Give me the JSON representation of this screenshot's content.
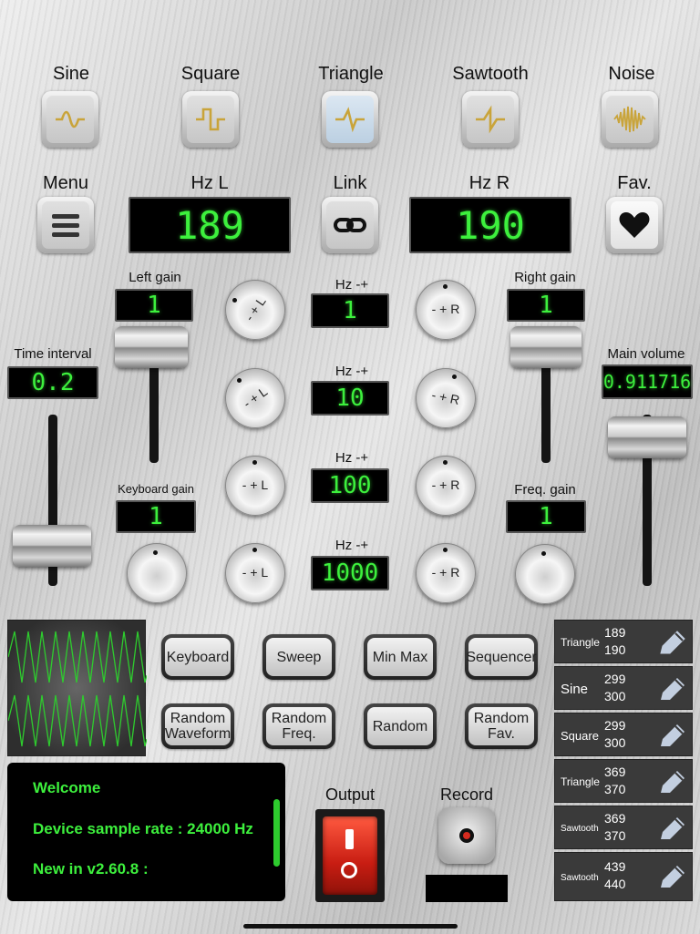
{
  "waveforms": [
    {
      "label": "Sine",
      "icon": "sine-wave-icon",
      "selected": false
    },
    {
      "label": "Square",
      "icon": "square-wave-icon",
      "selected": false
    },
    {
      "label": "Triangle",
      "icon": "triangle-wave-icon",
      "selected": true
    },
    {
      "label": "Sawtooth",
      "icon": "sawtooth-wave-icon",
      "selected": false
    },
    {
      "label": "Noise",
      "icon": "noise-wave-icon",
      "selected": false
    }
  ],
  "top": {
    "menu_label": "Menu",
    "hz_left_label": "Hz L",
    "hz_left_value": "189",
    "link_label": "Link",
    "hz_right_label": "Hz R",
    "hz_right_value": "190",
    "fav_label": "Fav."
  },
  "left": {
    "gain_label": "Left gain",
    "gain_value": "1",
    "keyboard_gain_label": "Keyboard gain",
    "keyboard_gain_value": "1",
    "time_interval_label": "Time interval",
    "time_interval_value": "0.2"
  },
  "right": {
    "gain_label": "Right gain",
    "gain_value": "1",
    "freq_gain_label": "Freq. gain",
    "freq_gain_value": "1",
    "main_volume_label": "Main volume",
    "main_volume_value": "0.911716"
  },
  "steps": [
    {
      "label": "Hz -+",
      "value": "1",
      "knob_l": "- + L",
      "knob_r": "- + R"
    },
    {
      "label": "Hz -+",
      "value": "10",
      "knob_l": "- + L",
      "knob_r": "- + R"
    },
    {
      "label": "Hz -+",
      "value": "100",
      "knob_l": "- + L",
      "knob_r": "- + R"
    },
    {
      "label": "Hz -+",
      "value": "1000",
      "knob_l": "- + L",
      "knob_r": "- + R"
    }
  ],
  "modes": [
    "Keyboard",
    "Sweep",
    "Min Max",
    "Sequencer",
    "Random Waveform",
    "Random Freq.",
    "Random",
    "Random Fav."
  ],
  "messages": [
    "Welcome",
    "Device sample rate : 24000 Hz",
    "New in v2.60.8 :"
  ],
  "output": {
    "output_label": "Output",
    "record_label": "Record"
  },
  "favorites": [
    {
      "waveform": "Triangle",
      "hz_l": "189",
      "hz_r": "190"
    },
    {
      "waveform": "Sine",
      "hz_l": "299",
      "hz_r": "300"
    },
    {
      "waveform": "Square",
      "hz_l": "299",
      "hz_r": "300"
    },
    {
      "waveform": "Triangle",
      "hz_l": "369",
      "hz_r": "370"
    },
    {
      "waveform": "Sawtooth",
      "hz_l": "369",
      "hz_r": "370"
    },
    {
      "waveform": "Sawtooth",
      "hz_l": "439",
      "hz_r": "440"
    }
  ],
  "colors": {
    "lcd_green": "#3df03d",
    "wave_icon": "#c9a43a",
    "output_red": "#d62b1f"
  }
}
